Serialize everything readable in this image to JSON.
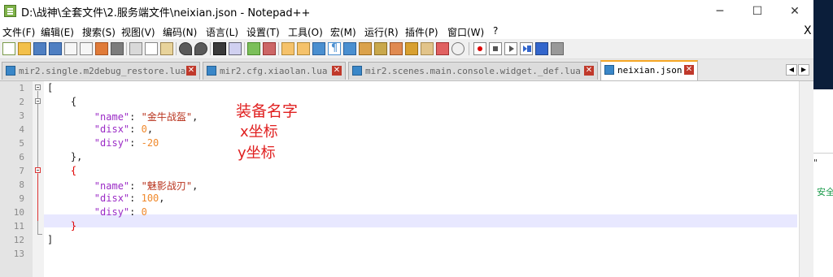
{
  "window": {
    "title": "D:\\战神\\全套文件\\2.服务端文件\\neixian.json - Notepad++",
    "minimize": "─",
    "maximize": "☐",
    "close": "✕"
  },
  "menu": {
    "items": [
      "文件(F)",
      "编辑(E)",
      "搜索(S)",
      "视图(V)",
      "编码(N)",
      "语言(L)",
      "设置(T)",
      "工具(O)",
      "宏(M)",
      "运行(R)",
      "插件(P)",
      "窗口(W)",
      "?"
    ],
    "close": "X"
  },
  "tabs": [
    {
      "label": "mir2.single.m2debug_restore.lua",
      "active": false
    },
    {
      "label": "mir2.cfg.xiaolan.lua",
      "active": false
    },
    {
      "label": "mir2.scenes.main.console.widget._def.lua",
      "active": false
    },
    {
      "label": "neixian.json",
      "active": true
    }
  ],
  "tab_nav": {
    "left": "◀",
    "right": "▶"
  },
  "editor": {
    "line_numbers": [
      "1",
      "2",
      "3",
      "4",
      "5",
      "6",
      "7",
      "8",
      "9",
      "10",
      "11",
      "12",
      "13"
    ],
    "lines": [
      {
        "indent": "",
        "parts": [
          [
            "punc",
            "["
          ]
        ]
      },
      {
        "indent": "    ",
        "parts": [
          [
            "punc",
            "{"
          ]
        ]
      },
      {
        "indent": "        ",
        "parts": [
          [
            "key",
            "\"name\""
          ],
          [
            "punc",
            ": "
          ],
          [
            "str",
            "\"金牛战盔\""
          ],
          [
            "punc",
            ","
          ]
        ]
      },
      {
        "indent": "        ",
        "parts": [
          [
            "key",
            "\"disx\""
          ],
          [
            "punc",
            ": "
          ],
          [
            "num",
            "0"
          ],
          [
            "punc",
            ","
          ]
        ]
      },
      {
        "indent": "        ",
        "parts": [
          [
            "key",
            "\"disy\""
          ],
          [
            "punc",
            ": "
          ],
          [
            "num",
            "-20"
          ]
        ]
      },
      {
        "indent": "    ",
        "parts": [
          [
            "punc",
            "},"
          ]
        ]
      },
      {
        "indent": "    ",
        "parts": [
          [
            "brace-hl",
            "{"
          ]
        ]
      },
      {
        "indent": "        ",
        "parts": [
          [
            "key",
            "\"name\""
          ],
          [
            "punc",
            ": "
          ],
          [
            "str",
            "\"魅影战刃\""
          ],
          [
            "punc",
            ","
          ]
        ]
      },
      {
        "indent": "        ",
        "parts": [
          [
            "key",
            "\"disx\""
          ],
          [
            "punc",
            ": "
          ],
          [
            "num",
            "100"
          ],
          [
            "punc",
            ","
          ]
        ]
      },
      {
        "indent": "        ",
        "parts": [
          [
            "key",
            "\"disy\""
          ],
          [
            "punc",
            ": "
          ],
          [
            "num",
            "0"
          ]
        ]
      },
      {
        "indent": "    ",
        "parts": [
          [
            "brace-hl",
            "}"
          ]
        ]
      },
      {
        "indent": "",
        "parts": [
          [
            "punc",
            "]"
          ]
        ]
      },
      {
        "indent": "",
        "parts": []
      }
    ]
  },
  "annotations": {
    "name_label": "装备名字",
    "x_label": "x坐标",
    "y_label": "y坐标"
  },
  "right_panel": {
    "text_quote": "\"",
    "text_safe": "安全"
  },
  "colors": {
    "key": "#9b2bc6",
    "string": "#b8321c",
    "number": "#f0892c",
    "annotation": "#e02020",
    "active_tab_accent": "#f5a623"
  }
}
